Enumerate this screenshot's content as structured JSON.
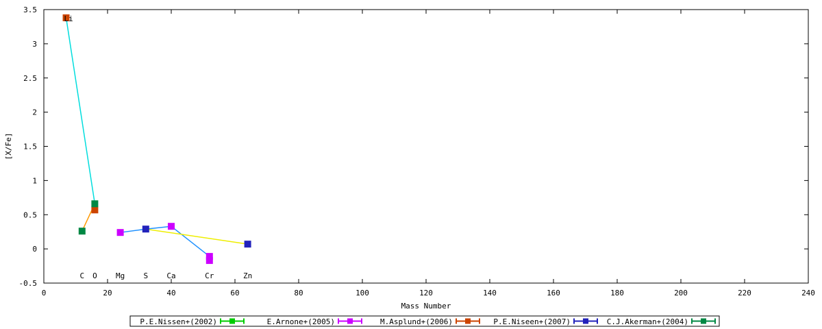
{
  "chart_data": {
    "type": "scatter",
    "xlabel": "Mass Number",
    "ylabel": "[X/Fe]",
    "xlim": [
      0,
      240
    ],
    "ylim": [
      -0.5,
      3.5
    ],
    "x_ticks": [
      0,
      20,
      40,
      60,
      80,
      100,
      120,
      140,
      160,
      180,
      200,
      220,
      240
    ],
    "y_ticks": [
      -0.5,
      0,
      0.5,
      1,
      1.5,
      2,
      2.5,
      3,
      3.5
    ],
    "x_tick_labels": [
      "0",
      "20",
      "40",
      "60",
      "80",
      "100",
      "120",
      "140",
      "160",
      "180",
      "200",
      "220",
      "240"
    ],
    "y_tick_labels": [
      "-0.5",
      "0",
      "0.5",
      "1",
      "1.5",
      "2",
      "2.5",
      "3",
      "3.5"
    ],
    "element_labels": [
      {
        "text": "C",
        "x": 12
      },
      {
        "text": "O",
        "x": 16
      },
      {
        "text": "Mg",
        "x": 24
      },
      {
        "text": "S",
        "x": 32
      },
      {
        "text": "Ca",
        "x": 40
      },
      {
        "text": "Cr",
        "x": 52
      },
      {
        "text": "Zn",
        "x": 64
      }
    ],
    "point_annotations": [
      {
        "text": "Li",
        "x": 7,
        "y": 3.38
      }
    ],
    "legend_position": "bottom",
    "series": [
      {
        "name": "P.E.Nissen+(2002)",
        "color": "#00cc00",
        "points": []
      },
      {
        "name": "E.Arnone+(2005)",
        "color": "#cc00ff",
        "points": [
          {
            "x": 24,
            "y": 0.24
          },
          {
            "x": 40,
            "y": 0.33
          },
          {
            "x": 52,
            "y": -0.11
          },
          {
            "x": 52,
            "y": -0.17
          }
        ]
      },
      {
        "name": "M.Asplund+(2006)",
        "color": "#cc4400",
        "points": [
          {
            "x": 7,
            "y": 3.38
          },
          {
            "x": 16,
            "y": 0.57
          }
        ]
      },
      {
        "name": "P.E.Niseen+(2007)",
        "color": "#2222bb",
        "points": [
          {
            "x": 32,
            "y": 0.29
          },
          {
            "x": 64,
            "y": 0.07
          }
        ]
      },
      {
        "name": "C.J.Akerman+(2004)",
        "color": "#008844",
        "points": [
          {
            "x": 12,
            "y": 0.26
          },
          {
            "x": 16,
            "y": 0.66
          }
        ]
      }
    ],
    "connectors": [
      {
        "color": "#00dddd",
        "from": {
          "x": 7,
          "y": 3.38
        },
        "to": {
          "x": 16,
          "y": 0.66
        }
      },
      {
        "color": "#ff9900",
        "from": {
          "x": 12,
          "y": 0.26
        },
        "to": {
          "x": 16,
          "y": 0.66
        }
      },
      {
        "color": "#1e90ff",
        "from": {
          "x": 24,
          "y": 0.24
        },
        "to": {
          "x": 32,
          "y": 0.29
        }
      },
      {
        "color": "#1e90ff",
        "from": {
          "x": 32,
          "y": 0.29
        },
        "to": {
          "x": 40,
          "y": 0.33
        }
      },
      {
        "color": "#1e90ff",
        "from": {
          "x": 40,
          "y": 0.33
        },
        "to": {
          "x": 52,
          "y": -0.11
        }
      },
      {
        "color": "#eeee00",
        "from": {
          "x": 32,
          "y": 0.29
        },
        "to": {
          "x": 64,
          "y": 0.07
        }
      }
    ]
  }
}
